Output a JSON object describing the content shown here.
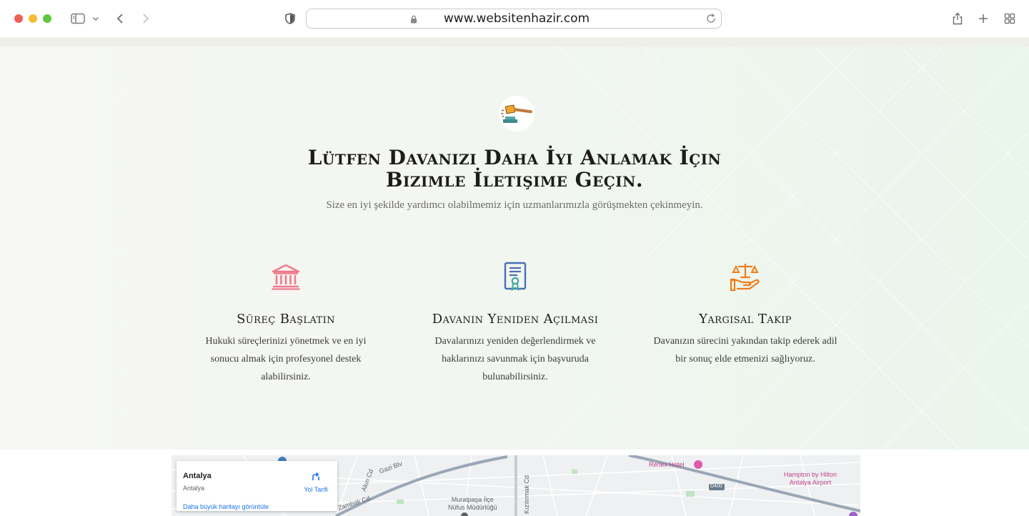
{
  "browser": {
    "url": "www.websitenhazir.com"
  },
  "hero": {
    "title_line1": "Lütfen Davanızı Daha İyi Anlamak İçin",
    "title_line2": "Bizimle İletişime Geçin.",
    "subtitle": "Size en iyi şekilde yardımcı olabilmemiz için uzmanlarımızla görüşmekten çekinmeyin.",
    "icon": "gavel-icon"
  },
  "features": [
    {
      "title": "Süreç Başlatın",
      "text": "Hukuki süreçlerinizi yönetmek ve en iyi sonucu almak için profesyonel destek alabilirsiniz.",
      "icon": "courthouse-icon",
      "color": "#f07a8c"
    },
    {
      "title": "Davanın Yeniden Açılması",
      "text": "Davalarınızı yeniden değerlendirmek ve haklarınızı savunmak için başvuruda bulunabilirsiniz.",
      "icon": "certificate-document-icon",
      "color": "#4a6fb5"
    },
    {
      "title": "Yargısal Takip",
      "text": "Davanızın sürecini yakından takip ederek adil bir sonuç elde etmenizi sağlıyoruz.",
      "icon": "scales-in-hand-icon",
      "color": "#ef7d1a"
    }
  ],
  "map": {
    "card": {
      "city": "Antalya",
      "region": "Antalya",
      "directions_label": "Yol Tarifi",
      "larger_map_link": "Daha büyük haritayı görüntüle"
    },
    "labels": {
      "renex": "Renex Hotel",
      "hampton_line1": "Hampton by Hilton",
      "hampton_line2": "Antalya Airport",
      "muratpasa_line1": "Muratpaşa İlçe",
      "muratpasa_line2": "Nüfus Müdürlüğü",
      "gazi": "Gazi Blv",
      "road": "D400",
      "zambak": "Zambak Cd",
      "kizilirmak": "Kızılırmak Cd",
      "akin": "Akın Cd"
    }
  }
}
